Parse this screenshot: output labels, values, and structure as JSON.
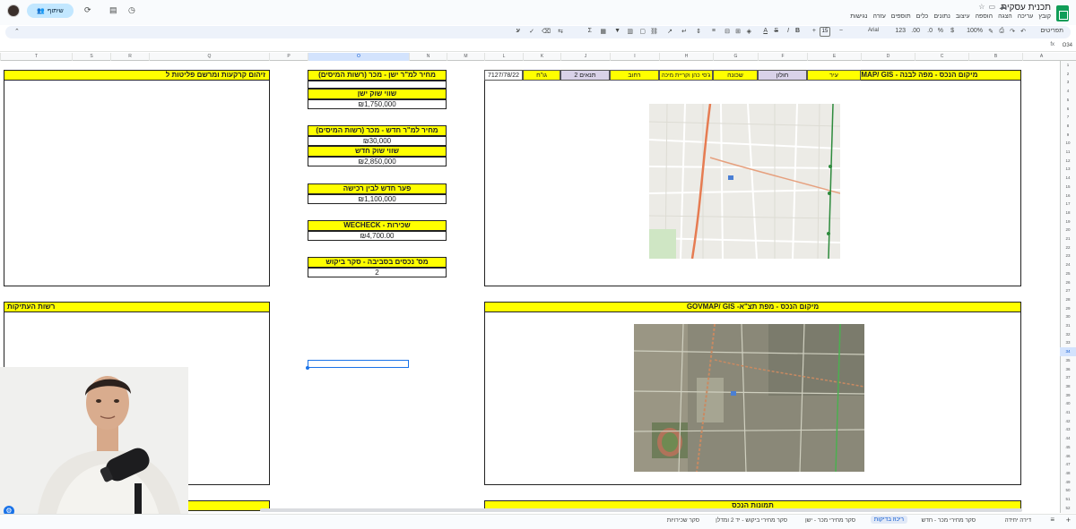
{
  "app": {
    "doc_title": "תכנית עסקית",
    "menu": [
      "קובץ",
      "עריכה",
      "הצגה",
      "הוספה",
      "עיצוב",
      "נתונים",
      "כלים",
      "תוספים",
      "עזרה",
      "נגישות"
    ],
    "share_label": "שיתוף",
    "name_box": "O34"
  },
  "toolbar": {
    "menus_label": "תפריטים",
    "zoom": "100%",
    "currency": "$",
    "percent": "%",
    "number_format": "123",
    "font": "Arial",
    "font_size": "15",
    "bold": "B",
    "italic": "I",
    "text_direction": "ע"
  },
  "columns": [
    "A",
    "B",
    "C",
    "D",
    "E",
    "F",
    "G",
    "H",
    "I",
    "J",
    "K",
    "L",
    "M",
    "N",
    "O",
    "P",
    "Q",
    "R",
    "S",
    "T"
  ],
  "selected_column": "O",
  "rows": [
    "1",
    "2",
    "3",
    "4",
    "5",
    "6",
    "7",
    "8",
    "9",
    "10",
    "11",
    "12",
    "13",
    "14",
    "15",
    "16",
    "17",
    "18",
    "19",
    "20",
    "21",
    "22",
    "23",
    "24",
    "25",
    "26",
    "27",
    "28",
    "29",
    "30",
    "31",
    "32",
    "33",
    "34",
    "35",
    "36",
    "37",
    "38",
    "39",
    "40",
    "41",
    "42",
    "43",
    "44",
    "45",
    "46",
    "47",
    "48",
    "49",
    "50",
    "51",
    "52"
  ],
  "selected_row": "34",
  "sheet": {
    "location_header": "GOVMAP/ GIS - מיקום הנכס - מפה לבנה",
    "city_label": "עיר",
    "city": "חולון",
    "neighborhood_label": "שכונה",
    "neighborhood": "ג'סי כהן וקריית מיכה",
    "street_label": "רחוב",
    "plans_label": "תנאים 2",
    "block_parcel_label": "גו\"ח",
    "block_parcel": "7127/78/22",
    "aerial_header": "GOVMAP/ GIS -מיקום הנכס - מפת תצ\"א",
    "photos_header": "תמונות הנכס",
    "old_price_header": "מחיר למ\"ר ישן - מכר (רשות המיסים)",
    "old_market_label": "שווי שוק ישן",
    "old_market_value": "₪1,750,000",
    "new_price_header": "מחיר למ\"ר חדש - מכר (רשות המיסים)",
    "new_price_value": "₪30,000",
    "new_market_label": "שווי שוק חדש",
    "new_market_value": "₪2,850,000",
    "gap_label": "פער חדש לבין רכישה",
    "gap_value": "₪1,100,000",
    "rent_label": "WECHECK - שכירות",
    "rent_value": "₪4,700.00",
    "demand_label": "מס' נכסים בסביבה - סקר ביקוש",
    "demand_value": "2",
    "land_header": "זיהום קרקעות ומרשם פליטות ל",
    "antiquities_header": "רשות העתיקות"
  },
  "sheet_tabs": [
    "דירה יחידה",
    "סקר מחירי מכר - חדש",
    "ריכוז בדיקות",
    "סקר מחירי מכר - ישן",
    "סקר מחירי ביקוש - יד 2 ומדלן",
    "סקר שכירויות"
  ],
  "active_tab": "ריכוז בדיקות"
}
